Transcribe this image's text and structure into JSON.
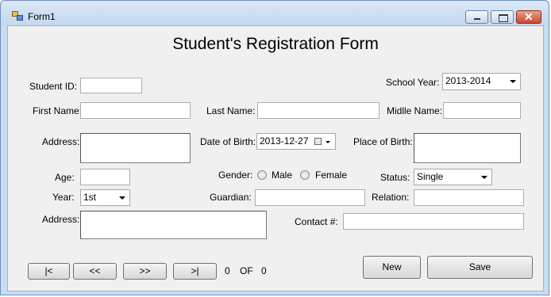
{
  "window": {
    "title": "Form1"
  },
  "form": {
    "heading": "Student's Registration Form",
    "student_id": {
      "label": "Student ID:",
      "value": ""
    },
    "school_year": {
      "label": "School Year:",
      "value": "2013-2014"
    },
    "first_name": {
      "label": "First Name:",
      "value": ""
    },
    "last_name": {
      "label": "Last Name:",
      "value": ""
    },
    "middle_name": {
      "label": "Midlle Name:",
      "value": ""
    },
    "address1": {
      "label": "Address:",
      "value": ""
    },
    "date_of_birth": {
      "label": "Date of Birth:",
      "value": "2013-12-27"
    },
    "place_of_birth": {
      "label": "Place of Birth:",
      "value": ""
    },
    "age": {
      "label": "Age:",
      "value": ""
    },
    "gender": {
      "label": "Gender:",
      "options": [
        "Male",
        "Female"
      ]
    },
    "status": {
      "label": "Status:",
      "value": "Single"
    },
    "year": {
      "label": "Year:",
      "value": "1st"
    },
    "guardian": {
      "label": "Guardian:",
      "value": ""
    },
    "relation": {
      "label": "Relation:",
      "value": ""
    },
    "address2": {
      "label": "Address:",
      "value": ""
    },
    "contact": {
      "label": "Contact #:",
      "value": ""
    }
  },
  "nav": {
    "first": "|<",
    "prev": "<<",
    "next": ">>",
    "last": ">|",
    "current": "0",
    "of": "OF",
    "total": "0"
  },
  "actions": {
    "new": "New",
    "save": "Save"
  }
}
